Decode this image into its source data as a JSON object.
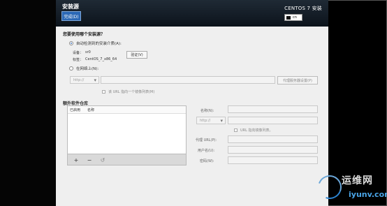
{
  "header": {
    "title": "安装源",
    "done_button": "完成(D)",
    "os_label": "CENTOS 7 安装",
    "keyboard": "cn"
  },
  "install_source": {
    "question": "您要使用哪个安装源？",
    "auto_detect_label": "自动检测到的安装介质(A):",
    "device_label": "设备：",
    "device_value": "sr0",
    "label_label": "标签：",
    "label_value": "CentOS_7_x86_64",
    "verify_button": "验证(V)",
    "network_label": "在网络上(N):",
    "protocol_value": "http://",
    "proxy_button": "代理服务器设置(P)",
    "mirror_label": "该 URL 指向一个镜像列表(M)"
  },
  "repos": {
    "title": "额外软件仓库",
    "columns": [
      "已启用",
      "名称"
    ],
    "name_label": "名称(N):",
    "protocol_value": "http://",
    "mirror_label": "URL 指向镜像列表。",
    "proxy_url_label": "代理 URL(P):",
    "username_label": "用户名(U):",
    "password_label": "密码(W):"
  },
  "watermark": {
    "text": "运维网",
    "url": "iyunv.com"
  }
}
